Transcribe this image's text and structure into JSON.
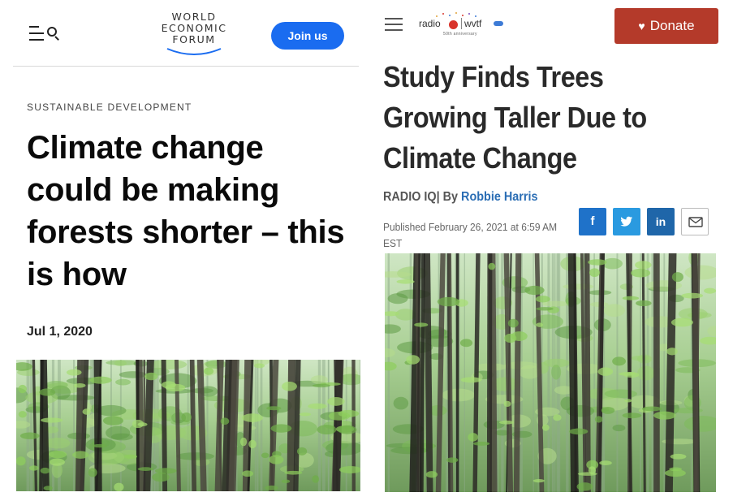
{
  "left": {
    "header": {
      "logo_lines": [
        "WORLD",
        "ECONOMIC",
        "FORUM"
      ],
      "join_label": "Join us",
      "menu_icon": "menu-search-icon"
    },
    "article": {
      "kicker": "SUSTAINABLE DEVELOPMENT",
      "title": "Climate change could be making forests shorter – this is how",
      "date": "Jul 1, 2020"
    },
    "colors": {
      "accent": "#1a6cf0"
    }
  },
  "right": {
    "header": {
      "logo_text_left": "radio",
      "logo_text_right": "wvtf",
      "logo_anniversary": "50th anniversary",
      "donate_label": "Donate",
      "donate_icon": "heart-icon"
    },
    "article": {
      "title": "Study Finds Trees Growing Taller Due to Climate Change",
      "source": "RADIO IQ",
      "by": "| By ",
      "author": "Robbie Harris",
      "published": "Published February 26, 2021 at 6:59 AM EST"
    },
    "share": {
      "facebook": "f",
      "twitter": "t",
      "linkedin": "in",
      "email_icon": "envelope-icon"
    },
    "colors": {
      "donate": "#b43a2a",
      "author_link": "#2a6db4"
    }
  }
}
